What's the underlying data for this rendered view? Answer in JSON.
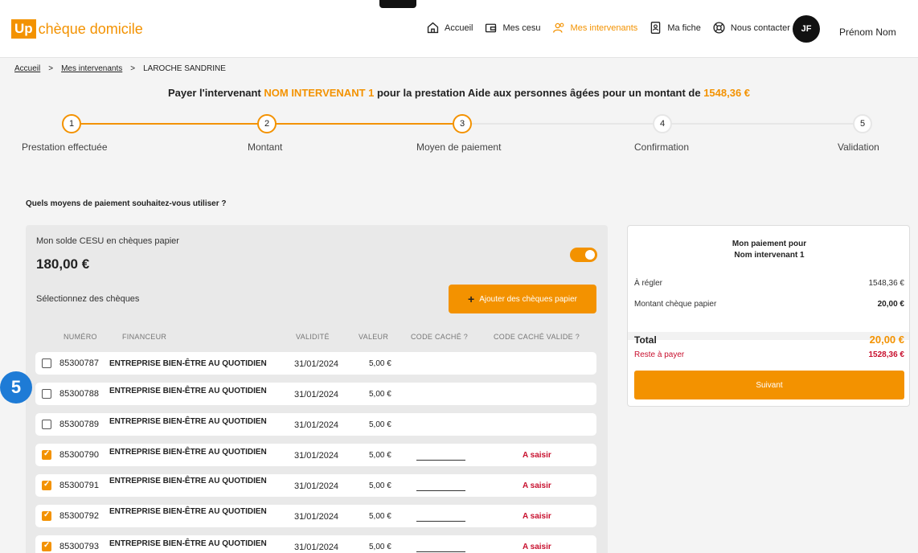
{
  "header": {
    "logo_up": "Up",
    "logo_text": "chèque domicile",
    "nav": [
      {
        "label": "Accueil",
        "icon": "home-icon",
        "active": false
      },
      {
        "label": "Mes cesu",
        "icon": "wallet-icon",
        "active": false
      },
      {
        "label": "Mes intervenants",
        "icon": "users-icon",
        "active": true
      },
      {
        "label": "Ma fiche",
        "icon": "id-card-icon",
        "active": false
      },
      {
        "label": "Nous contacter",
        "icon": "help-icon",
        "active": false
      }
    ],
    "avatar_initials": "JF",
    "user_name": "Prénom Nom"
  },
  "breadcrumb": {
    "items": [
      "Accueil",
      "Mes intervenants",
      "LAROCHE SANDRINE"
    ],
    "separator": ">"
  },
  "payment_title": {
    "prefix": "Payer l'intervenant ",
    "intervenant": "NOM INTERVENANT 1",
    "middle": " pour la prestation Aide aux personnes âgées pour un montant de ",
    "amount": "1548,36 €"
  },
  "stepper": {
    "steps": [
      {
        "number": "1",
        "label": "Prestation effectuée",
        "done": true
      },
      {
        "number": "2",
        "label": "Montant",
        "done": true
      },
      {
        "number": "3",
        "label": "Moyen de paiement",
        "done": true
      },
      {
        "number": "4",
        "label": "Confirmation",
        "done": false
      },
      {
        "number": "5",
        "label": "Validation",
        "done": false
      }
    ]
  },
  "question": "Quels moyens de paiement souhaitez-vous utiliser ?",
  "cesu_panel": {
    "solde_label": "Mon solde CESU en chèques papier",
    "solde_amount": "180,00 €",
    "toggle_on": true,
    "select_label": "Sélectionnez des chèques",
    "add_button": "Ajouter des chèques papier",
    "columns": [
      "NUMÉRO",
      "FINANCEUR",
      "VALIDITÉ",
      "VALEUR",
      "CODE CACHÉ ?",
      "CODE CACHÉ VALIDE ?"
    ],
    "rows": [
      {
        "checked": false,
        "numero": "85300787",
        "financeur": "ENTREPRISE BIEN-ÊTRE AU QUOTIDIEN",
        "validite": "31/01/2024",
        "valeur": "5,00 €",
        "code_valide": ""
      },
      {
        "checked": false,
        "numero": "85300788",
        "financeur": "ENTREPRISE BIEN-ÊTRE AU QUOTIDIEN",
        "validite": "31/01/2024",
        "valeur": "5,00 €",
        "code_valide": ""
      },
      {
        "checked": false,
        "numero": "85300789",
        "financeur": "ENTREPRISE BIEN-ÊTRE AU QUOTIDIEN",
        "validite": "31/01/2024",
        "valeur": "5,00 €",
        "code_valide": ""
      },
      {
        "checked": true,
        "numero": "85300790",
        "financeur": "ENTREPRISE BIEN-ÊTRE AU QUOTIDIEN",
        "validite": "31/01/2024",
        "valeur": "5,00 €",
        "code_valide": "A saisir"
      },
      {
        "checked": true,
        "numero": "85300791",
        "financeur": "ENTREPRISE BIEN-ÊTRE AU QUOTIDIEN",
        "validite": "31/01/2024",
        "valeur": "5,00 €",
        "code_valide": "A saisir"
      },
      {
        "checked": true,
        "numero": "85300792",
        "financeur": "ENTREPRISE BIEN-ÊTRE AU QUOTIDIEN",
        "validite": "31/01/2024",
        "valeur": "5,00 €",
        "code_valide": "A saisir"
      },
      {
        "checked": true,
        "numero": "85300793",
        "financeur": "ENTREPRISE BIEN-ÊTRE AU QUOTIDIEN",
        "validite": "31/01/2024",
        "valeur": "5,00 €",
        "code_valide": "A saisir"
      }
    ]
  },
  "summary": {
    "title_line1": "Mon paiement pour",
    "title_line2": "Nom intervenant 1",
    "a_regler_label": "À régler",
    "a_regler_value": "1548,36 €",
    "cheque_label": "Montant chèque papier",
    "cheque_value": "20,00 €",
    "total_label": "Total",
    "total_value": "20,00 €",
    "reste_label": "Reste à payer",
    "reste_value": "1528,36 €",
    "next_button": "Suivant"
  },
  "annotation_badge": "5",
  "colors": {
    "accent": "#f39200",
    "error": "#c8102e",
    "badge": "#1e7bd6"
  }
}
